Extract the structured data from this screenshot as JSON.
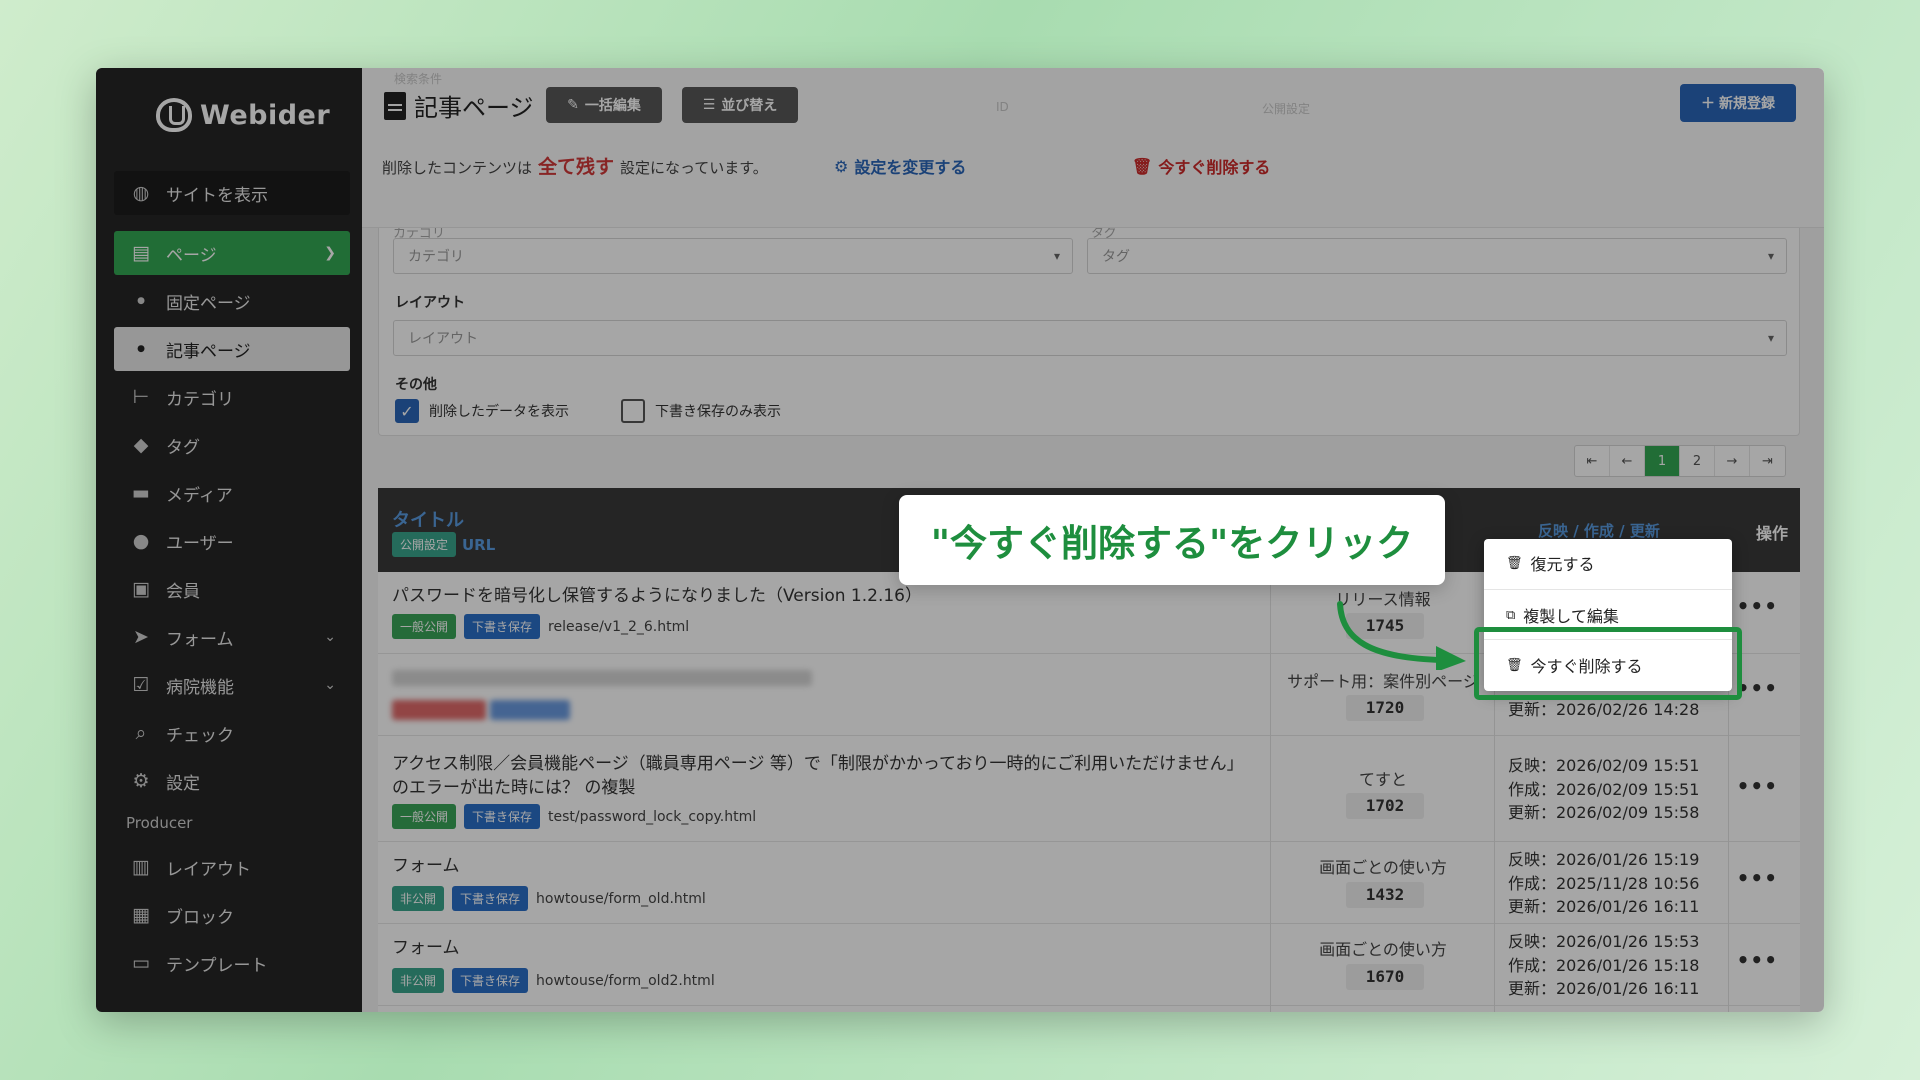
{
  "brand": {
    "logo_text": "Webider"
  },
  "sidebar": {
    "view_site": "サイトを表示",
    "items": [
      {
        "label": "ページ",
        "icon": "file-icon"
      },
      {
        "label": "固定ページ",
        "icon": "bullet-icon"
      },
      {
        "label": "記事ページ",
        "icon": "bullet-icon"
      },
      {
        "label": "カテゴリ",
        "icon": "tree-icon"
      },
      {
        "label": "タグ",
        "icon": "tag-icon"
      },
      {
        "label": "メディア",
        "icon": "folder-icon"
      },
      {
        "label": "ユーザー",
        "icon": "user-icon"
      },
      {
        "label": "会員",
        "icon": "id-card-icon"
      },
      {
        "label": "フォーム",
        "icon": "send-icon"
      },
      {
        "label": "病院機能",
        "icon": "clipboard-check-icon"
      },
      {
        "label": "チェック",
        "icon": "search-icon"
      },
      {
        "label": "設定",
        "icon": "gear-icon"
      }
    ],
    "producer_heading": "Producer",
    "producer_items": [
      {
        "label": "レイアウト",
        "icon": "layout-icon"
      },
      {
        "label": "ブロック",
        "icon": "grid-icon"
      },
      {
        "label": "テンプレート",
        "icon": "monitor-icon"
      }
    ]
  },
  "header": {
    "title": "記事ページ",
    "bulk_edit": "一括編集",
    "sort": "並び替え",
    "new": "新規登録",
    "notice_pre": "削除したコンテンツは",
    "notice_keep": "全て残す",
    "notice_post": "設定になっています。",
    "change_setting": "設定を変更する",
    "delete_now": "今すぐ削除する"
  },
  "filters": {
    "category_label": "カテゴリ",
    "category_placeholder": "カテゴリ",
    "tag_label": "タグ",
    "tag_placeholder": "タグ",
    "layout_label": "レイアウト",
    "layout_placeholder": "レイアウト",
    "other_label": "その他",
    "show_deleted": "削除したデータを表示",
    "show_deleted_checked": true,
    "drafts_only": "下書き保存のみ表示",
    "drafts_only_checked": false,
    "ghost_id": "ID",
    "ghost_public": "公開設定",
    "ghost_search": "検索条件"
  },
  "pager": {
    "pages": [
      "1",
      "2"
    ],
    "current": "1"
  },
  "table": {
    "col_title": "タイトル",
    "col_public": "公開設定",
    "col_url": "URL",
    "col_dates": "反映 / 作成 / 更新",
    "col_ops": "操作",
    "rows": [
      {
        "title": "パスワードを暗号化し保管するようになりました（Version 1.2.16）",
        "status": "一般公開",
        "draft": "下書き保存",
        "url": "release/v1_2_6.html",
        "category": "リリース情報",
        "id": "1745",
        "dates": []
      },
      {
        "title": "",
        "status": "",
        "draft": "",
        "url": "",
        "category": "サポート用：案件別ページ",
        "id": "1720",
        "dates": [
          "更新：2026/02/26 14:28"
        ]
      },
      {
        "title": "アクセス制限／会員機能ページ（職員専用ページ 等）で「制限がかかっており一時的にご利用いただけません」のエラーが出た時には？ の複製",
        "status": "一般公開",
        "draft": "下書き保存",
        "url": "test/password_lock_copy.html",
        "category": "てすと",
        "id": "1702",
        "dates": [
          "反映：2026/02/09 15:51",
          "作成：2026/02/09 15:51",
          "更新：2026/02/09 15:58"
        ]
      },
      {
        "title": "フォーム",
        "status": "非公開",
        "draft": "下書き保存",
        "url": "howtouse/form_old.html",
        "category": "画面ごとの使い方",
        "id": "1432",
        "dates": [
          "反映：2026/01/26 15:19",
          "作成：2025/11/28 10:56",
          "更新：2026/01/26 16:11"
        ]
      },
      {
        "title": "フォーム",
        "status": "非公開",
        "draft": "下書き保存",
        "url": "howtouse/form_old2.html",
        "category": "画面ごとの使い方",
        "id": "1670",
        "dates": [
          "反映：2026/01/26 15:53",
          "作成：2026/01/26 15:18",
          "更新：2026/01/26 16:11"
        ]
      }
    ]
  },
  "menu": {
    "restore": "復元する",
    "duplicate": "複製して編集",
    "delete_now": "今すぐ削除する"
  },
  "callout": {
    "text": "\"今すぐ削除する\"をクリック"
  },
  "colors": {
    "accent_green": "#34a853",
    "primary_blue": "#2a66b8",
    "danger_red": "#cc2a2a",
    "callout_green": "#1e8e3e"
  }
}
